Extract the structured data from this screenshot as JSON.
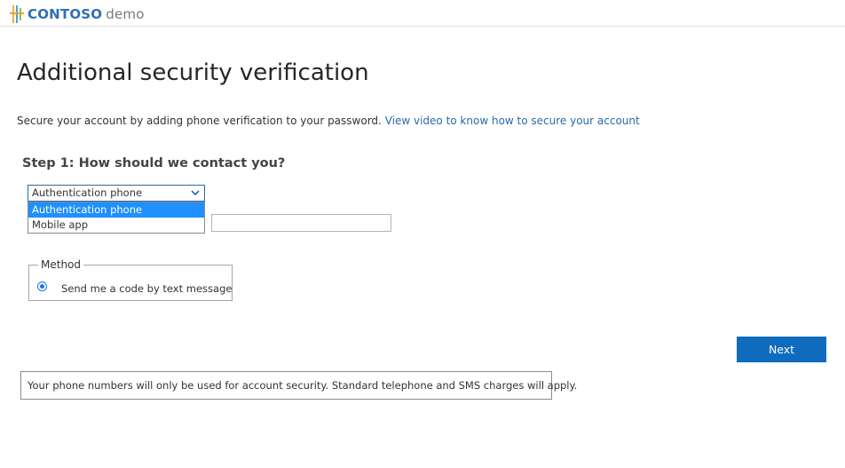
{
  "header": {
    "company": "CONTOSO",
    "suffix": "demo"
  },
  "page": {
    "title": "Additional security verification",
    "intro_text": "Secure your account by adding phone verification to your password.",
    "intro_link": "View video to know how to secure your account"
  },
  "step1": {
    "title": "Step 1: How should we contact you?",
    "select": {
      "value": "Authentication phone",
      "options": [
        "Authentication phone",
        "Mobile app"
      ],
      "highlighted": "Authentication phone"
    },
    "phone_input": {
      "value": "",
      "placeholder": ""
    }
  },
  "method": {
    "legend": "Method",
    "option_label": "Send me a code by text message",
    "selected": true
  },
  "actions": {
    "next_label": "Next"
  },
  "notice": {
    "text": "Your phone numbers will only be used for account security. Standard telephone and SMS charges will apply."
  },
  "colors": {
    "brand": "#2f6fb3",
    "accent": "#0f6cbd",
    "highlight": "#1e90ff",
    "link": "#2a6aa8"
  },
  "icons": [
    "contoso-logo-icon",
    "chevron-down-icon",
    "radio-selected-icon"
  ]
}
